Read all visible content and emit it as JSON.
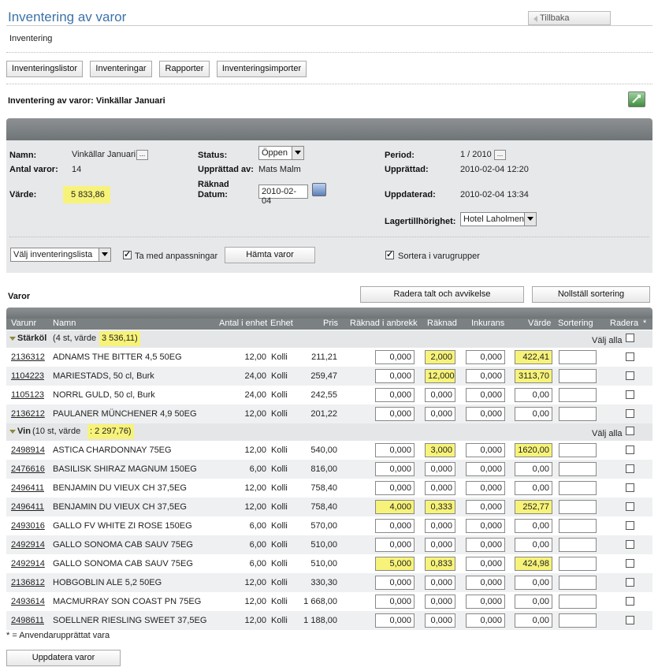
{
  "page_title": "Inventering av varor",
  "back_label": "Tillbaka",
  "breadcrumb": "Inventering",
  "tabs": [
    "Inventeringslistor",
    "Inventeringar",
    "Rapporter",
    "Inventeringsimporter"
  ],
  "section_title": "Inventering av varor: Vinkällar Januari",
  "form": {
    "namn_label": "Namn:",
    "namn_value": "Vinkällar Januari",
    "antal_label": "Antal varor:",
    "antal_value": "14",
    "varde_label": "Värde:",
    "varde_value": "5 833,86",
    "status_label": "Status:",
    "status_value": "Öppen",
    "upprattad_av_label": "Upprättad av:",
    "upprattad_av_value": "Mats Malm",
    "raknad_label": "Räknad",
    "datum_label": "Datum:",
    "datum_value": "2010-02-04",
    "period_label": "Period:",
    "period_value": "1 / 2010",
    "upprattad_label": "Upprättad:",
    "upprattad_value": "2010-02-04 12:20",
    "uppdaterad_label": "Uppdaterad:",
    "uppdaterad_value": "2010-02-04 13:34",
    "lager_label": "Lagertillhörighet:",
    "lager_value": "Hotel Laholmen",
    "list_select": "Välj inventeringslista",
    "anpassningar_label": "Ta med anpassningar",
    "hamta_label": "Hämta varor",
    "sortera_label": "Sortera i varugrupper",
    "dots": "..."
  },
  "varor_title": "Varor",
  "radera_btn": "Radera talt och avvikelse",
  "nollstall_btn": "Nollställ sortering",
  "columns": [
    "Varunr",
    "Namn",
    "Antal i enhet",
    "Enhet",
    "Pris",
    "Räknad i anbrekk",
    "Räknad",
    "Inkurans",
    "Värde",
    "Sortering",
    "Radera",
    "*"
  ],
  "groups": [
    {
      "name": "Stärköl",
      "meta": " (4 st, värde ",
      "value": "3 536,11)",
      "valj_alla": "Välj alla",
      "rows": [
        {
          "nr": "2136312",
          "namn": "ADNAMS THE BITTER 4,5 50EG",
          "antal": "12,00",
          "enhet": "Kolli",
          "pris": "211,21",
          "anbrekk": "0,000",
          "raknad": "2,000",
          "inkurans": "0,000",
          "varde": "422,41"
        },
        {
          "nr": "1104223",
          "namn": "MARIESTADS, 50 cl, Burk",
          "antal": "24,00",
          "enhet": "Kolli",
          "pris": "259,47",
          "anbrekk": "0,000",
          "raknad": "12,000",
          "inkurans": "0,000",
          "varde": "3113,70"
        },
        {
          "nr": "1105123",
          "namn": "NORRL GULD, 50 cl, Burk",
          "antal": "24,00",
          "enhet": "Kolli",
          "pris": "242,55",
          "anbrekk": "0,000",
          "raknad": "0,000",
          "inkurans": "0,000",
          "varde": "0,00"
        },
        {
          "nr": "2136212",
          "namn": "PAULANER MÜNCHENER 4,9 50EG",
          "antal": "12,00",
          "enhet": "Kolli",
          "pris": "201,22",
          "anbrekk": "0,000",
          "raknad": "0,000",
          "inkurans": "0,000",
          "varde": "0,00"
        }
      ]
    },
    {
      "name": "Vin",
      "meta": " (10 st, värde ",
      "value": ": 2 297,76)",
      "valj_alla": "Välj alla",
      "rows": [
        {
          "nr": "2498914",
          "namn": "ASTICA CHARDONNAY 75EG",
          "antal": "12,00",
          "enhet": "Kolli",
          "pris": "540,00",
          "anbrekk": "0,000",
          "raknad": "3,000",
          "inkurans": "0,000",
          "varde": "1620,00"
        },
        {
          "nr": "2476616",
          "namn": "BASILISK SHIRAZ MAGNUM 150EG",
          "antal": "6,00",
          "enhet": "Kolli",
          "pris": "816,00",
          "anbrekk": "0,000",
          "raknad": "0,000",
          "inkurans": "0,000",
          "varde": "0,00"
        },
        {
          "nr": "2496411",
          "namn": "BENJAMIN DU VIEUX CH 37,5EG",
          "antal": "12,00",
          "enhet": "Kolli",
          "pris": "758,40",
          "anbrekk": "0,000",
          "raknad": "0,000",
          "inkurans": "0,000",
          "varde": "0,00"
        },
        {
          "nr": "2496411",
          "namn": "BENJAMIN DU VIEUX CH 37,5EG",
          "antal": "12,00",
          "enhet": "Kolli",
          "pris": "758,40",
          "anbrekk": "4,000",
          "raknad": "0,333",
          "inkurans": "0,000",
          "varde": "252,77"
        },
        {
          "nr": "2493016",
          "namn": "GALLO FV WHITE ZI ROSE 150EG",
          "antal": "6,00",
          "enhet": "Kolli",
          "pris": "570,00",
          "anbrekk": "0,000",
          "raknad": "0,000",
          "inkurans": "0,000",
          "varde": "0,00"
        },
        {
          "nr": "2492914",
          "namn": "GALLO SONOMA CAB SAUV 75EG",
          "antal": "6,00",
          "enhet": "Kolli",
          "pris": "510,00",
          "anbrekk": "0,000",
          "raknad": "0,000",
          "inkurans": "0,000",
          "varde": "0,00"
        },
        {
          "nr": "2492914",
          "namn": "GALLO SONOMA CAB SAUV 75EG",
          "antal": "6,00",
          "enhet": "Kolli",
          "pris": "510,00",
          "anbrekk": "5,000",
          "raknad": "0,833",
          "inkurans": "0,000",
          "varde": "424,98"
        },
        {
          "nr": "2136812",
          "namn": "HOBGOBLIN ALE 5,2 50EG",
          "antal": "12,00",
          "enhet": "Kolli",
          "pris": "330,30",
          "anbrekk": "0,000",
          "raknad": "0,000",
          "inkurans": "0,000",
          "varde": "0,00"
        },
        {
          "nr": "2493614",
          "namn": "MACMURRAY SON COAST PN 75EG",
          "antal": "12,00",
          "enhet": "Kolli",
          "pris": "1 668,00",
          "anbrekk": "0,000",
          "raknad": "0,000",
          "inkurans": "0,000",
          "varde": "0,00"
        },
        {
          "nr": "2498611",
          "namn": "SOELLNER RIESLING SWEET 37,5EG",
          "antal": "12,00",
          "enhet": "Kolli",
          "pris": "1 188,00",
          "anbrekk": "0,000",
          "raknad": "0,000",
          "inkurans": "0,000",
          "varde": "0,00"
        }
      ]
    }
  ],
  "footnote": "* = Anvendarupprättat vara",
  "update_btn": "Uppdatera varor",
  "colors": {
    "title": "#3a73a8",
    "highlight": "#f7f37a",
    "bar": "#7b8083"
  }
}
